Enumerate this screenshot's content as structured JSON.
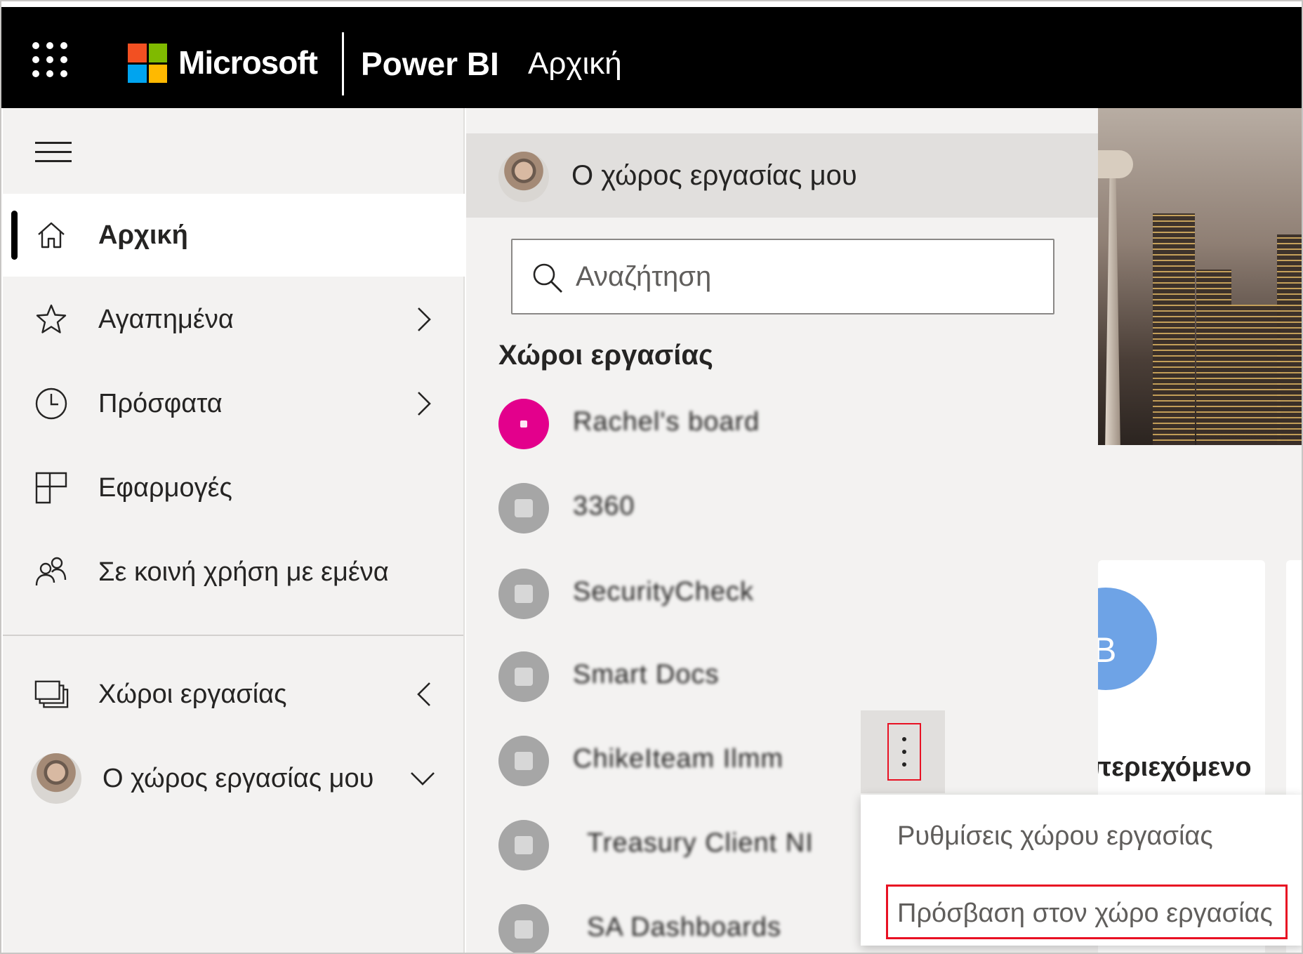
{
  "header": {
    "brand": "Microsoft",
    "app": "Power BI",
    "page": "Αρχική"
  },
  "nav": {
    "items": [
      {
        "label": "Αρχική",
        "icon": "home-icon",
        "active": true
      },
      {
        "label": "Αγαπημένα",
        "icon": "star-icon"
      },
      {
        "label": "Πρόσφατα",
        "icon": "clock-icon"
      },
      {
        "label": "Εφαρμογές",
        "icon": "apps-icon"
      },
      {
        "label": "Σε κοινή χρήση με εμένα",
        "icon": "shared-icon"
      },
      {
        "label": "Χώροι εργασίας",
        "icon": "workspaces-icon"
      },
      {
        "label": "Ο χώρος εργασίας μου",
        "icon": "avatar"
      }
    ]
  },
  "flyout": {
    "header": "Ο χώρος εργασίας μου",
    "search_placeholder": "Αναζήτηση",
    "section": "Χώροι εργασίας",
    "workspaces": [
      {
        "name": "Rachel's board",
        "color": "#e3008c"
      },
      {
        "name": "3360",
        "color": "#a6a6a6"
      },
      {
        "name": "SecurityCheck",
        "color": "#a6a6a6"
      },
      {
        "name": "Smart Docs",
        "color": "#a6a6a6"
      },
      {
        "name": "ChikeIteam Ilmm",
        "color": "#a6a6a6"
      },
      {
        "name": "Treasury Client NI",
        "color": "#a6a6a6"
      },
      {
        "name": "SA Dashboards",
        "color": "#a6a6a6"
      }
    ]
  },
  "context_menu": {
    "items": [
      "Ρυθμίσεις χώρου εργασίας",
      "Πρόσβαση στον χώρο εργασίας"
    ]
  },
  "background": {
    "card_letter": "B",
    "card_label": "περιεχόμενο"
  },
  "colors": {
    "header_bg": "#000000",
    "nav_bg": "#f3f2f1",
    "highlight": "#e81123",
    "ms_red": "#f25022",
    "ms_green": "#7fba00",
    "ms_blue": "#00a4ef",
    "ms_yellow": "#ffb900"
  }
}
